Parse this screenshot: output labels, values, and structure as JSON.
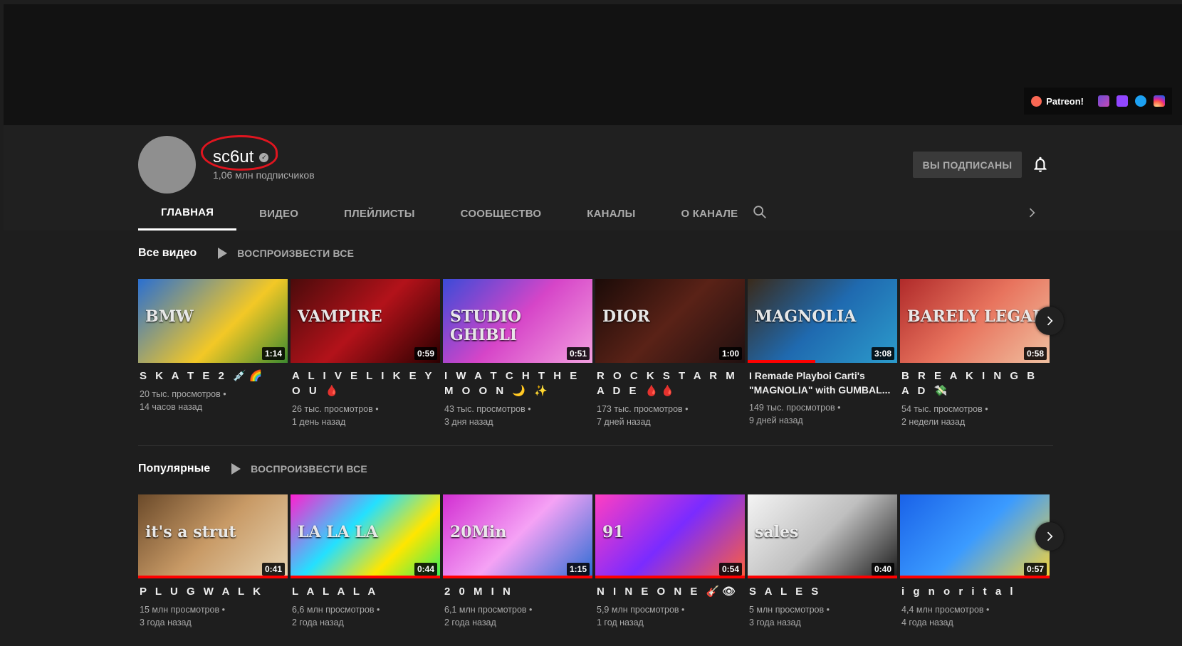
{
  "banner": {
    "patreon_label": "Patreon!",
    "social_icons": [
      "patreon-icon",
      "film-icon",
      "twitch-icon",
      "twitter-icon",
      "instagram-icon"
    ]
  },
  "channel": {
    "name": "sc6ut",
    "subscribers": "1,06 млн подписчиков",
    "subscribed_label": "ВЫ ПОДПИСАНЫ"
  },
  "tabs": [
    "ГЛАВНАЯ",
    "ВИДЕО",
    "ПЛЕЙЛИСТЫ",
    "СООБЩЕСТВО",
    "КАНАЛЫ",
    "О КАНАЛЕ"
  ],
  "shelves": [
    {
      "title": "Все видео",
      "play_all": "ВОСПРОИЗВЕСТИ ВСЕ",
      "videos": [
        {
          "title": "S K A T E  2 💉🌈",
          "views": "20 тыс. просмотров •",
          "age": "14 часов назад",
          "duration": "1:14",
          "thumb_text": "BMW",
          "progress": 0
        },
        {
          "title": "A L I V E  L I K E  Y O U  🩸",
          "views": "26 тыс. просмотров •",
          "age": "1 день назад",
          "duration": "0:59",
          "thumb_text": "VAMPIRE",
          "progress": 0
        },
        {
          "title": "I  W A T C H  T H E  M O O N 🌙 ✨",
          "views": "43 тыс. просмотров •",
          "age": "3 дня назад",
          "duration": "0:51",
          "thumb_text": "STUDIO GHIBLI",
          "progress": 0
        },
        {
          "title": "R O C K S T A R M A D E 🩸🩸",
          "views": "173 тыс. просмотров •",
          "age": "7 дней назад",
          "duration": "1:00",
          "thumb_text": "DIOR",
          "progress": 0
        },
        {
          "title": "I Remade Playboi Carti's \"MAGNOLIA\" with GUMBAL...",
          "views": "149 тыс. просмотров •",
          "age": "9 дней назад",
          "duration": "3:08",
          "thumb_text": "MAGNOLIA",
          "progress": 0.45
        },
        {
          "title": "B R E A K I N G  B A D 💸",
          "views": "54 тыс. просмотров •",
          "age": "2 недели назад",
          "duration": "0:58",
          "thumb_text": "BARELY LEGAL",
          "progress": 0
        }
      ]
    },
    {
      "title": "Популярные",
      "play_all": "ВОСПРОИЗВЕСТИ ВСЕ",
      "videos": [
        {
          "title": "P L U G W A L K",
          "views": "15 млн просмотров •",
          "age": "3 года назад",
          "duration": "0:41",
          "thumb_text": "it's a strut",
          "progress": 1
        },
        {
          "title": "L A  L A  L A",
          "views": "6,6 млн просмотров •",
          "age": "2 года назад",
          "duration": "0:44",
          "thumb_text": "LA LA LA",
          "progress": 1
        },
        {
          "title": "2 0  M I N",
          "views": "6,1 млн просмотров •",
          "age": "2 года назад",
          "duration": "1:15",
          "thumb_text": "20Min",
          "progress": 1
        },
        {
          "title": "N I N E  O N E 🎸👁",
          "views": "5,9 млн просмотров •",
          "age": "1 год назад",
          "duration": "0:54",
          "thumb_text": "91",
          "progress": 1
        },
        {
          "title": "S A L E S",
          "views": "5 млн просмотров •",
          "age": "3 года назад",
          "duration": "0:40",
          "thumb_text": "sales",
          "progress": 1
        },
        {
          "title": "i g n o r i t a l",
          "views": "4,4 млн просмотров •",
          "age": "4 года назад",
          "duration": "0:57",
          "thumb_text": "",
          "progress": 1
        }
      ]
    }
  ],
  "colors": {
    "background": "#1e1e1e",
    "header": "#202020",
    "accent_red": "#ff0000",
    "muted_text": "#aaaaaa"
  }
}
